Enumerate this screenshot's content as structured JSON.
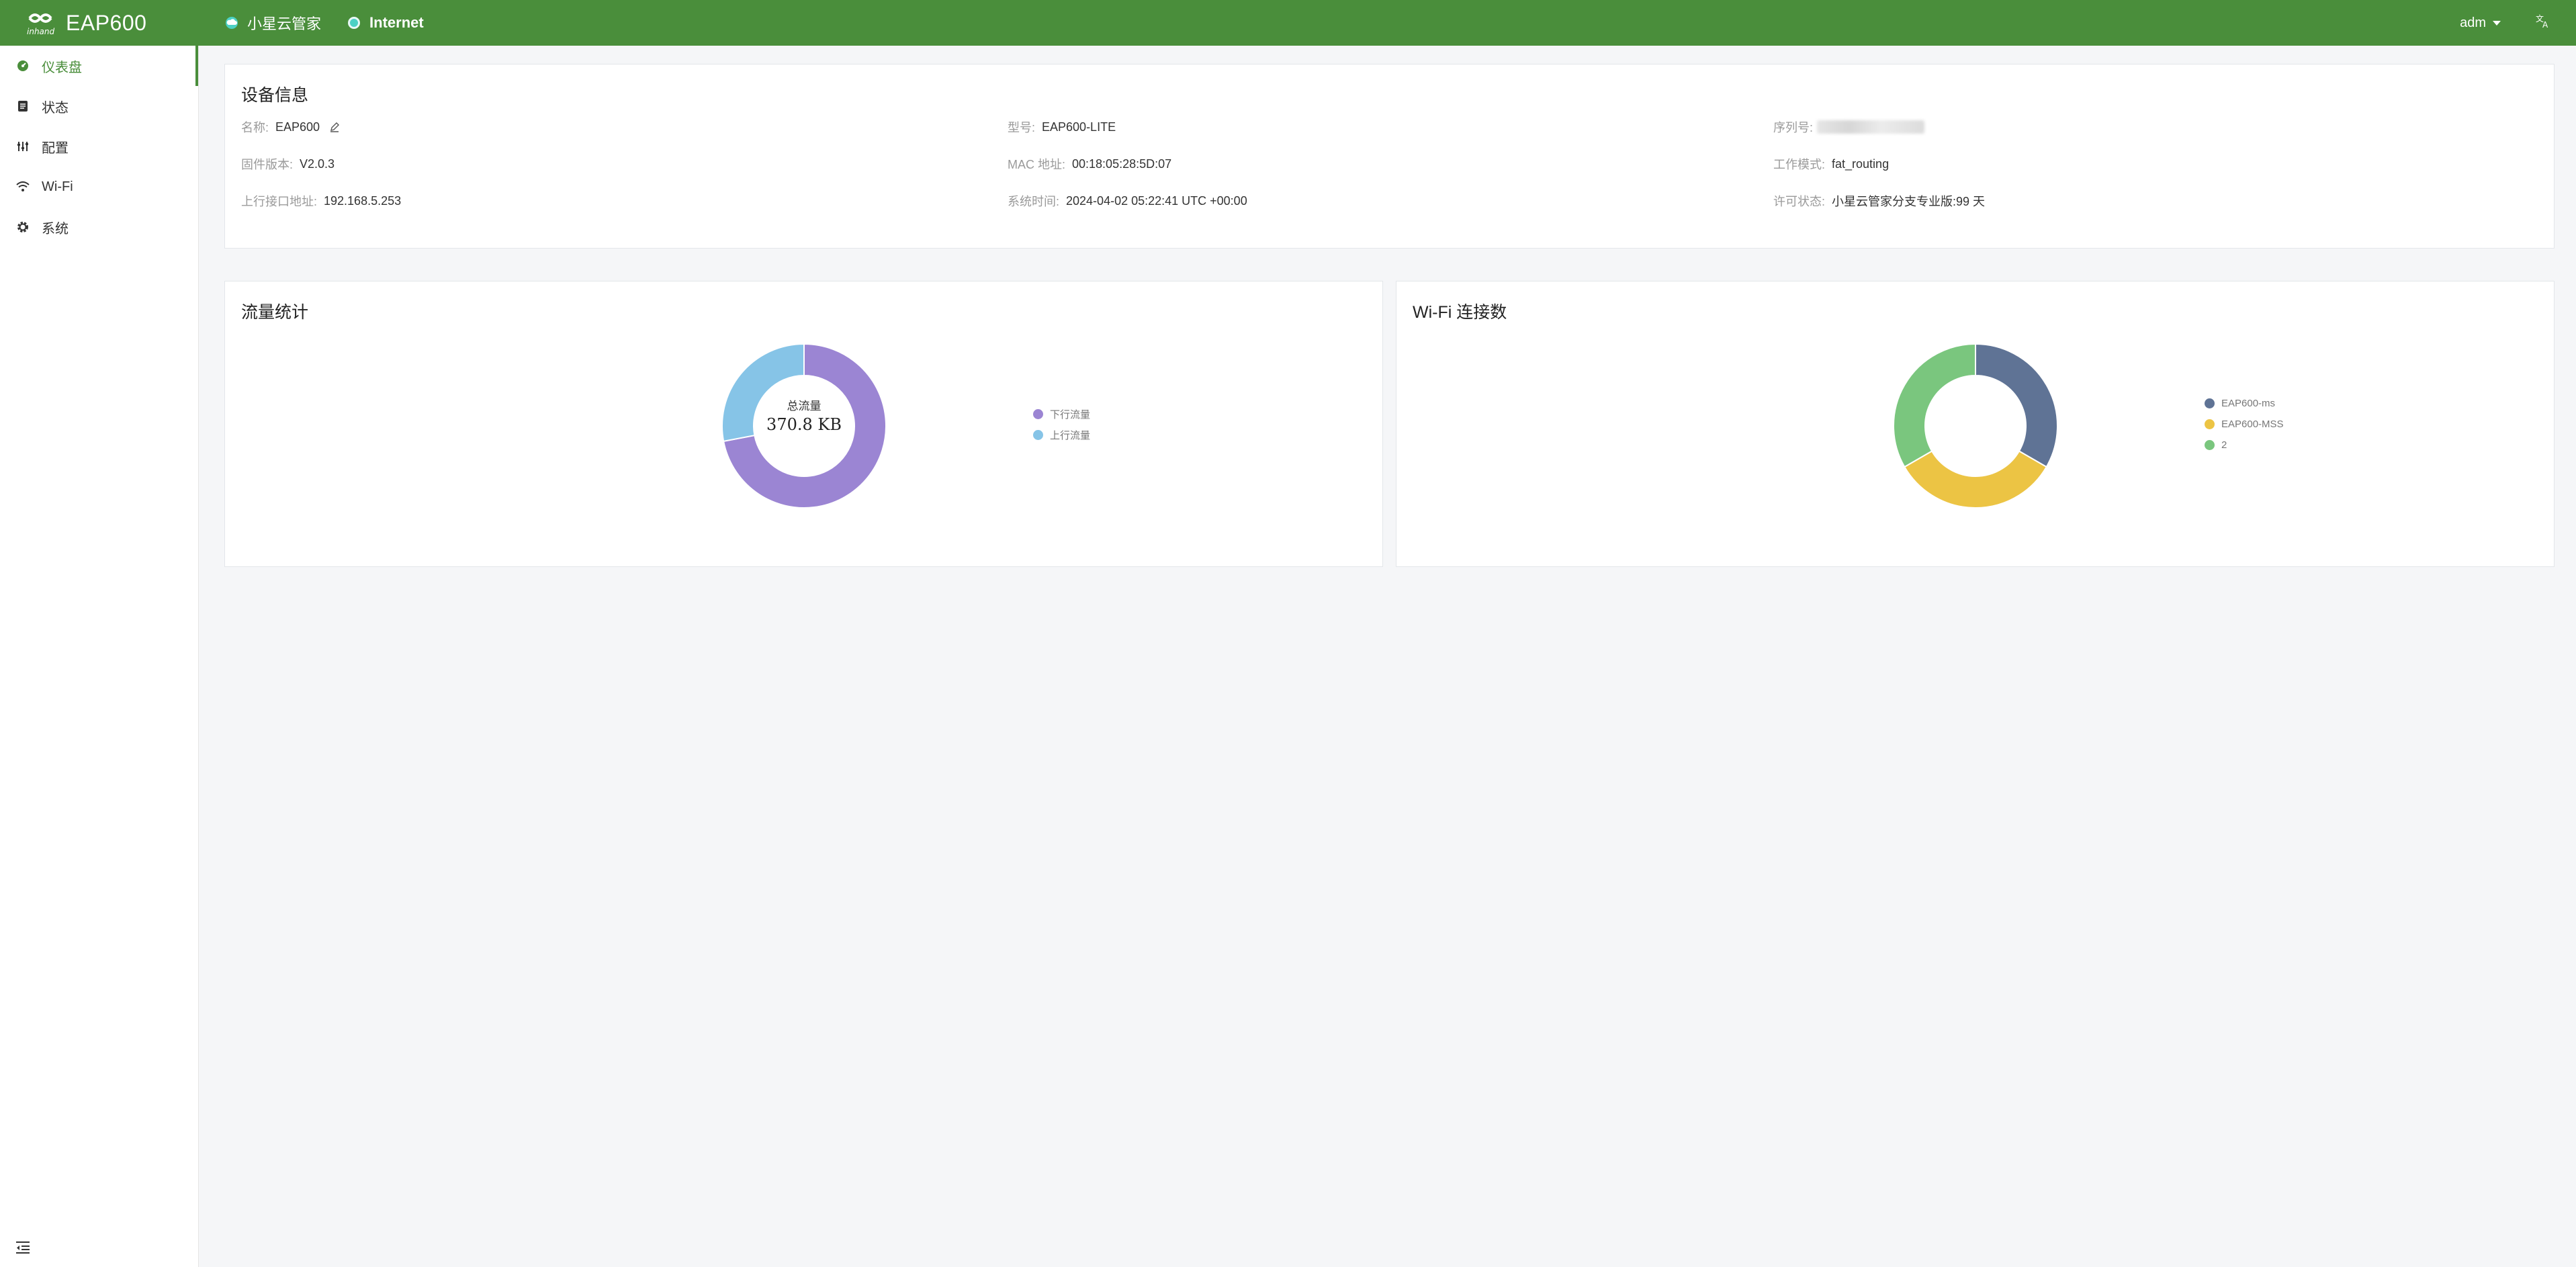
{
  "header": {
    "product": "EAP600",
    "links": [
      {
        "label": "小星云管家",
        "icon": "cloud-icon"
      },
      {
        "label": "Internet",
        "icon": "status-dot-icon"
      }
    ],
    "user": "adm",
    "language_icon": "translate-icon"
  },
  "sidebar": {
    "items": [
      {
        "label": "仪表盘",
        "icon": "dashboard-icon",
        "active": true
      },
      {
        "label": "状态",
        "icon": "document-icon"
      },
      {
        "label": "配置",
        "icon": "sliders-icon"
      },
      {
        "label": "Wi-Fi",
        "icon": "wifi-icon"
      },
      {
        "label": "系统",
        "icon": "gear-icon"
      }
    ],
    "collapse_icon": "collapse-menu-icon"
  },
  "device_info": {
    "title": "设备信息",
    "name_label": "名称:",
    "name_value": "EAP600",
    "model_label": "型号:",
    "model_value": "EAP600-LITE",
    "serial_label": "序列号:",
    "firmware_label": "固件版本:",
    "firmware_value": "V2.0.3",
    "mac_label": "MAC 地址:",
    "mac_value": "00:18:05:28:5D:07",
    "mode_label": "工作模式:",
    "mode_value": "fat_routing",
    "uplink_label": "上行接口地址:",
    "uplink_value": "192.168.5.253",
    "time_label": "系统时间:",
    "time_value": "2024-04-02 05:22:41 UTC +00:00",
    "license_label": "许可状态:",
    "license_value": "小星云管家分支专业版:99 天"
  },
  "traffic": {
    "title": "流量统计",
    "center_label": "总流量",
    "center_value": "370.8 KB"
  },
  "wifi": {
    "title": "Wi-Fi 连接数"
  },
  "chart_data": [
    {
      "type": "pie",
      "title": "流量统计",
      "labels": [
        "下行流量",
        "上行流量"
      ],
      "values": [
        72,
        28
      ],
      "colors": [
        "#9b85d3",
        "#86c4e7"
      ]
    },
    {
      "type": "pie",
      "title": "Wi-Fi 连接数",
      "labels": [
        "EAP600-ms",
        "EAP600-MSS",
        "2"
      ],
      "values": [
        1,
        1,
        1
      ],
      "colors": [
        "#5f7395",
        "#ecc444",
        "#7ac67e"
      ]
    }
  ],
  "colors": {
    "brand": "#4a8e3b",
    "background": "#f5f6f8"
  }
}
